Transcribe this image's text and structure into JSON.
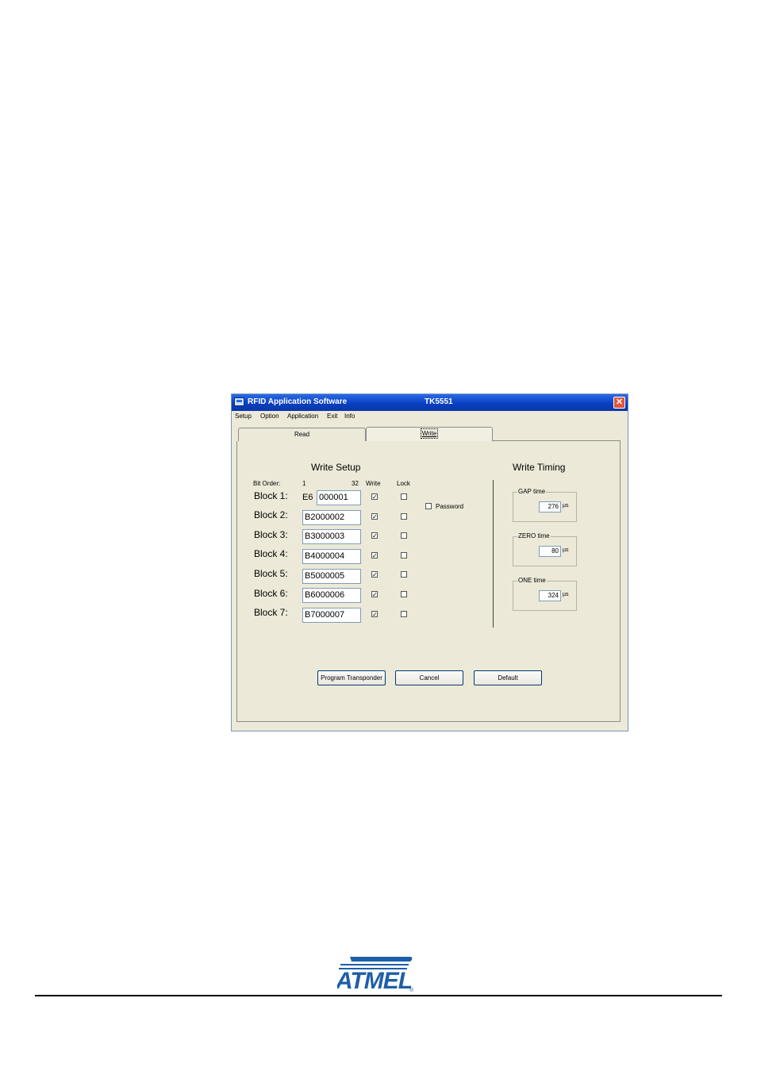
{
  "window": {
    "title": "RFID Application Software",
    "model": "TK5551"
  },
  "menu": [
    "Setup",
    "Option",
    "Application",
    "Exit",
    "Info"
  ],
  "tabs": [
    {
      "label": "Read",
      "active": false
    },
    {
      "label": "Write",
      "active": true
    }
  ],
  "write_setup": {
    "heading": "Write Setup",
    "bit_order_label": "Bit Order:",
    "bit_start": "1",
    "bit_end": "32",
    "write_col": "Write",
    "lock_col": "Lock",
    "password_label": "Password",
    "password_checked": false,
    "block1_prefix": "E6",
    "blocks": [
      {
        "label": "Block 1:",
        "value": "000001",
        "write": true,
        "lock": false
      },
      {
        "label": "Block 2:",
        "value": "B2000002",
        "write": true,
        "lock": false
      },
      {
        "label": "Block 3:",
        "value": "B3000003",
        "write": true,
        "lock": false
      },
      {
        "label": "Block 4:",
        "value": "B4000004",
        "write": true,
        "lock": false
      },
      {
        "label": "Block 5:",
        "value": "B5000005",
        "write": true,
        "lock": false
      },
      {
        "label": "Block 6:",
        "value": "B6000006",
        "write": true,
        "lock": false
      },
      {
        "label": "Block 7:",
        "value": "B7000007",
        "write": true,
        "lock": false
      }
    ]
  },
  "write_timing": {
    "heading": "Write Timing",
    "unit": "µs",
    "gap": {
      "label": "GAP time",
      "value": "276"
    },
    "zero": {
      "label": "ZERO time",
      "value": "80"
    },
    "one": {
      "label": "ONE time",
      "value": "324"
    }
  },
  "buttons": {
    "program": "Program Transponder",
    "cancel": "Cancel",
    "default": "Default"
  },
  "logo_text": "ATMEL",
  "colors": {
    "title_bar": "#0a3fc2",
    "logo": "#1f5fa8",
    "panel": "#ece9d8"
  }
}
